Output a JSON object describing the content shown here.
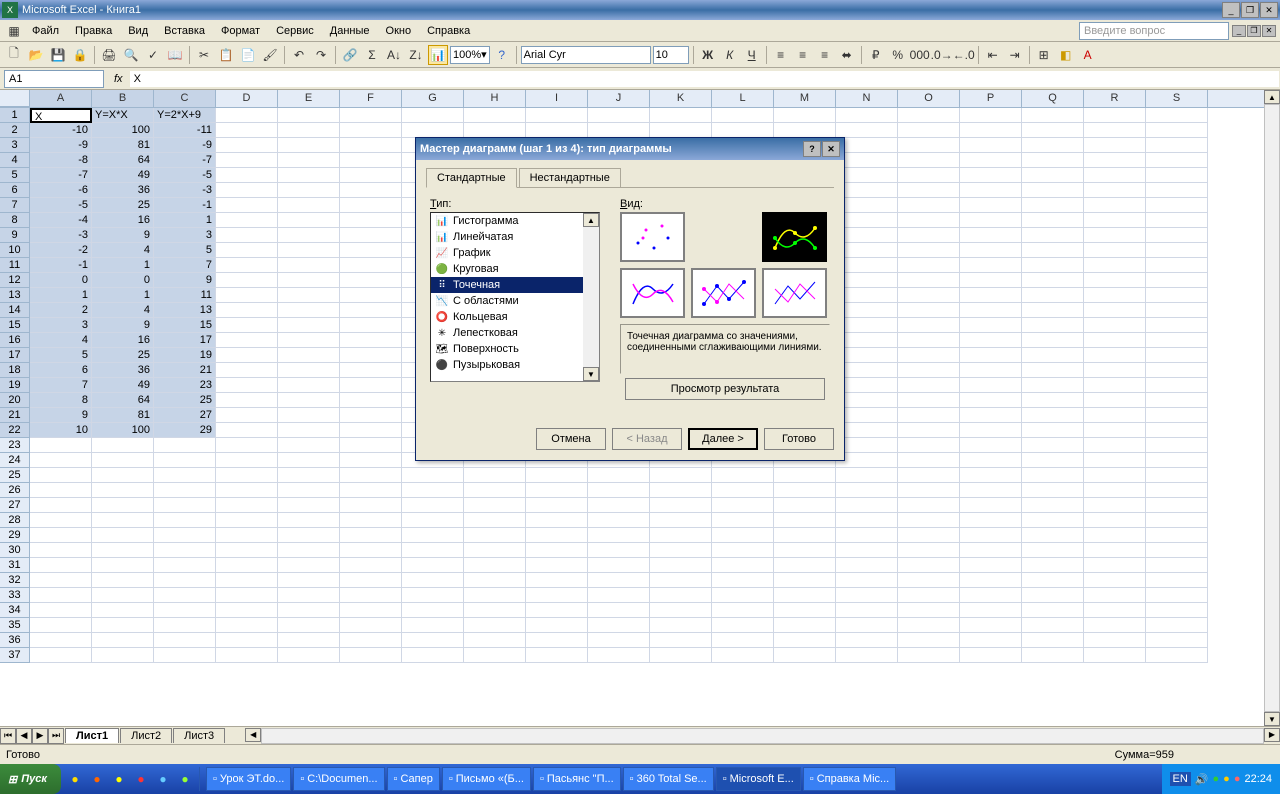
{
  "app": {
    "title": "Microsoft Excel - Книга1"
  },
  "menus": [
    "Файл",
    "Правка",
    "Вид",
    "Вставка",
    "Формат",
    "Сервис",
    "Данные",
    "Окно",
    "Справка"
  ],
  "question_placeholder": "Введите вопрос",
  "zoom": "100%",
  "font_name": "Arial Cyr",
  "font_size": "10",
  "name_box": "A1",
  "formula": "X",
  "columns": [
    "A",
    "B",
    "C",
    "D",
    "E",
    "F",
    "G",
    "H",
    "I",
    "J",
    "K",
    "L",
    "M",
    "N",
    "O",
    "P",
    "Q",
    "R",
    "S"
  ],
  "headers": [
    "X",
    "Y=X*X",
    "Y=2*X+9"
  ],
  "data_rows": [
    [
      "-10",
      "100",
      "-11"
    ],
    [
      "-9",
      "81",
      "-9"
    ],
    [
      "-8",
      "64",
      "-7"
    ],
    [
      "-7",
      "49",
      "-5"
    ],
    [
      "-6",
      "36",
      "-3"
    ],
    [
      "-5",
      "25",
      "-1"
    ],
    [
      "-4",
      "16",
      "1"
    ],
    [
      "-3",
      "9",
      "3"
    ],
    [
      "-2",
      "4",
      "5"
    ],
    [
      "-1",
      "1",
      "7"
    ],
    [
      "0",
      "0",
      "9"
    ],
    [
      "1",
      "1",
      "11"
    ],
    [
      "2",
      "4",
      "13"
    ],
    [
      "3",
      "9",
      "15"
    ],
    [
      "4",
      "16",
      "17"
    ],
    [
      "5",
      "25",
      "19"
    ],
    [
      "6",
      "36",
      "21"
    ],
    [
      "7",
      "49",
      "23"
    ],
    [
      "8",
      "64",
      "25"
    ],
    [
      "9",
      "81",
      "27"
    ],
    [
      "10",
      "100",
      "29"
    ]
  ],
  "sheets": [
    "Лист1",
    "Лист2",
    "Лист3"
  ],
  "status": "Готово",
  "sum": "Сумма=959",
  "dialog": {
    "title": "Мастер диаграмм (шаг 1 из 4): тип диаграммы",
    "tab_standard": "Стандартные",
    "tab_custom": "Нестандартные",
    "type_label": "Тип:",
    "view_label": "Вид:",
    "types": [
      "Гистограмма",
      "Линейчатая",
      "График",
      "Круговая",
      "Точечная",
      "С областями",
      "Кольцевая",
      "Лепестковая",
      "Поверхность",
      "Пузырьковая"
    ],
    "selected_type": 4,
    "description": "Точечная диаграмма со значениями, соединенными сглаживающими линиями.",
    "preview": "Просмотр результата",
    "cancel": "Отмена",
    "back": "< Назад",
    "next": "Далее >",
    "finish": "Готово"
  },
  "taskbar": {
    "start": "Пуск",
    "items": [
      "Урок ЭТ.do...",
      "C:\\Documen...",
      "Сапер",
      "Письмо «(Б...",
      "Пасьянс \"П...",
      "360 Total Se...",
      "Microsoft E...",
      "Справка Mic..."
    ],
    "lang": "EN",
    "time": "22:24"
  }
}
